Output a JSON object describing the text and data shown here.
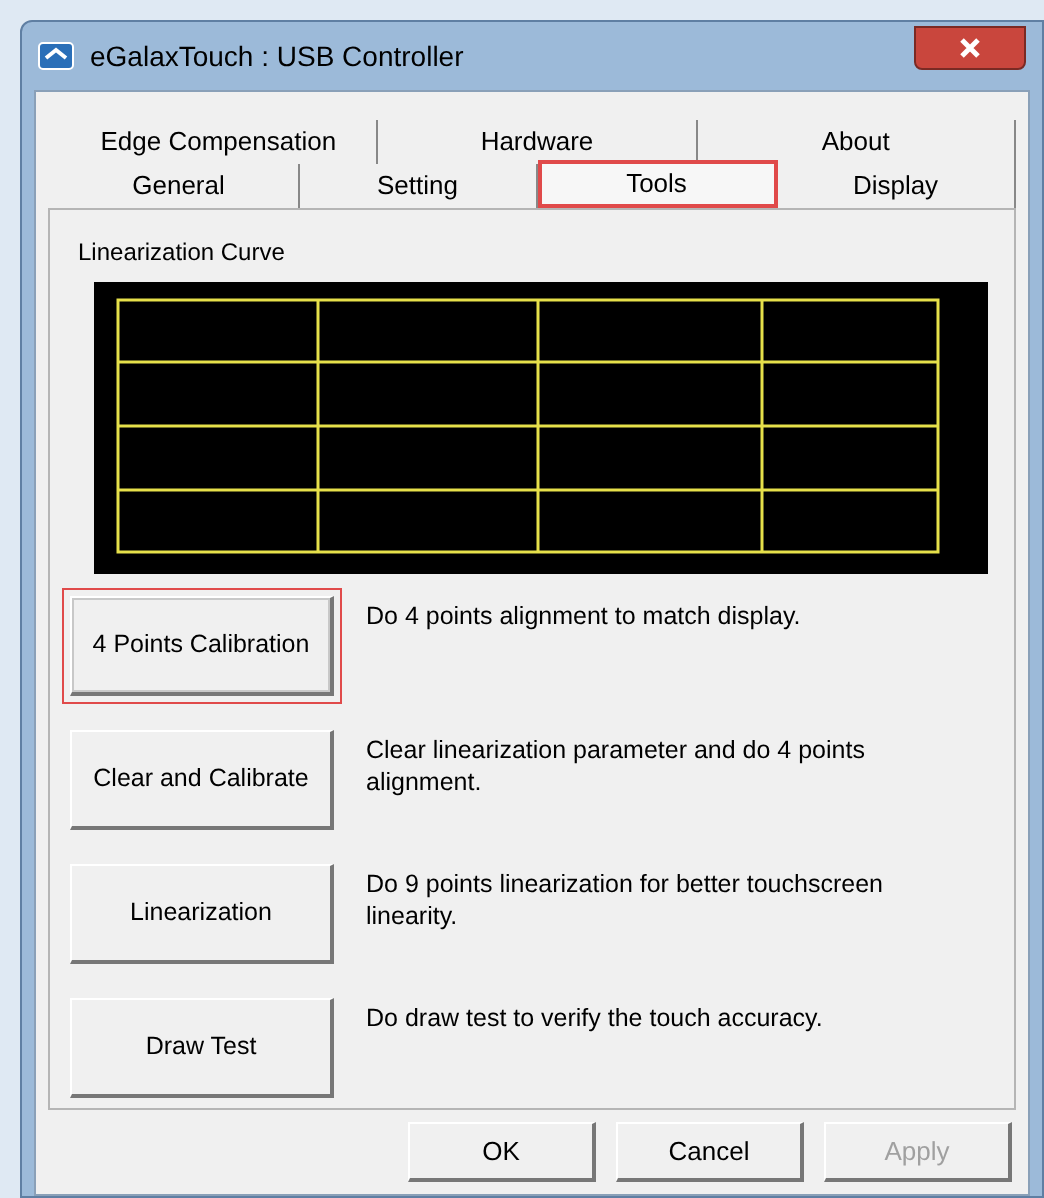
{
  "window": {
    "title": "eGalaxTouch : USB Controller"
  },
  "tab_rows": [
    {
      "tabs": [
        {
          "label": "Edge Compensation",
          "selected": false,
          "highlighted": false
        },
        {
          "label": "Hardware",
          "selected": false,
          "highlighted": false
        },
        {
          "label": "About",
          "selected": false,
          "highlighted": false
        }
      ]
    },
    {
      "tabs": [
        {
          "label": "General",
          "selected": false,
          "highlighted": false
        },
        {
          "label": "Setting",
          "selected": false,
          "highlighted": false
        },
        {
          "label": "Tools",
          "selected": true,
          "highlighted": true
        },
        {
          "label": "Display",
          "selected": false,
          "highlighted": false
        }
      ]
    }
  ],
  "curve": {
    "label": "Linearization Curve"
  },
  "actions": [
    {
      "button": "4 Points Calibration",
      "description": "Do 4 points alignment to match display.",
      "highlighted": true
    },
    {
      "button": "Clear and Calibrate",
      "description": "Clear linearization parameter and do 4 points alignment.",
      "highlighted": false
    },
    {
      "button": "Linearization",
      "description": "Do 9 points linearization for better touchscreen linearity.",
      "highlighted": false
    },
    {
      "button": "Draw Test",
      "description": "Do draw test to verify the touch accuracy.",
      "highlighted": false
    }
  ],
  "buttons": [
    {
      "label": "OK",
      "disabled": false
    },
    {
      "label": "Cancel",
      "disabled": false
    },
    {
      "label": "Apply",
      "disabled": true
    }
  ]
}
